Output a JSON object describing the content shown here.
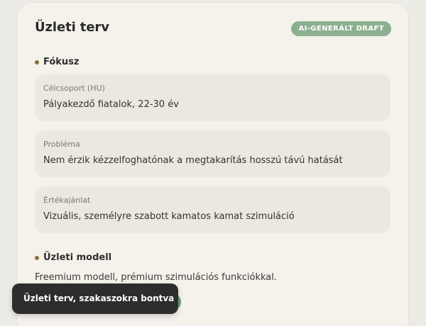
{
  "plan": {
    "title": "Üzleti terv",
    "badge": "AI-GENERÁLT DRAFT"
  },
  "focus": {
    "heading": "Fókusz",
    "fields": [
      {
        "label": "Célcsoport (HU)",
        "value": "Pályakezdő fiatalok, 22-30 év"
      },
      {
        "label": "Probléma",
        "value": "Nem érzik kézzelfoghatónak a megtakarítás hosszú távú hatását"
      },
      {
        "label": "Értékajánlat",
        "value": "Vizuális, személyre szabott kamatos kamat szimuláció"
      }
    ]
  },
  "business_model": {
    "heading": "Üzleti modell",
    "text": "Freemium modell, prémium szimulációs funkciókkal."
  },
  "toast": {
    "text": "Üzleti terv, szakaszokra bontva"
  },
  "colors": {
    "badge_bg": "#8cb08f",
    "bullet": "#8a6f3c",
    "toast_bg": "#2d2e2b",
    "green_accent": "#6fa074"
  }
}
